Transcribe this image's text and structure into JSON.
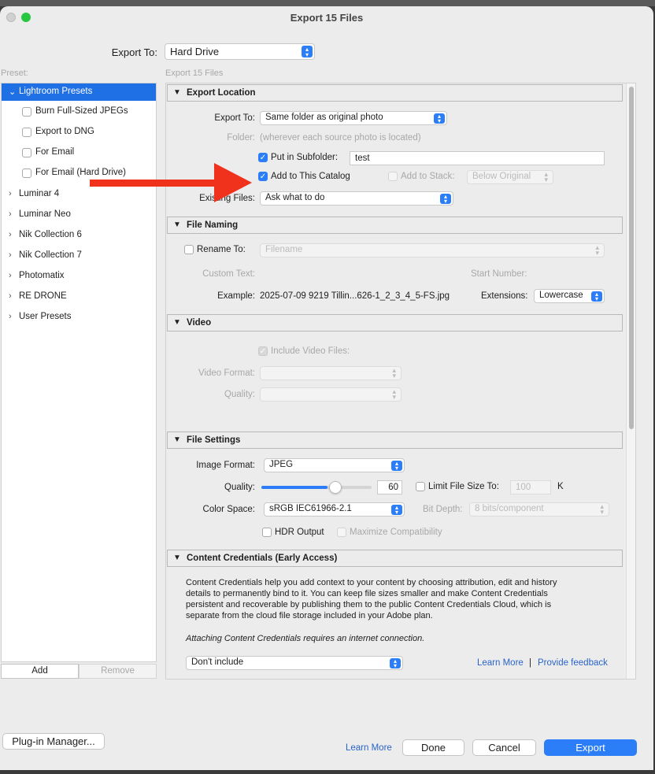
{
  "window": {
    "title": "Export 15 Files"
  },
  "header": {
    "export_to_label": "Export To:",
    "export_to_value": "Hard Drive",
    "subtitle": "Export 15 Files"
  },
  "sidebar": {
    "preset_label": "Preset:",
    "groups": [
      {
        "label": "Lightroom Presets",
        "expanded": true
      },
      {
        "label": "Luminar 4"
      },
      {
        "label": "Luminar Neo"
      },
      {
        "label": "Nik Collection 6"
      },
      {
        "label": "Nik Collection 7"
      },
      {
        "label": "Photomatix"
      },
      {
        "label": "RE DRONE"
      },
      {
        "label": "User Presets"
      }
    ],
    "presets": [
      "Burn Full-Sized JPEGs",
      "Export to DNG",
      "For Email",
      "For Email (Hard Drive)"
    ],
    "add_label": "Add",
    "remove_label": "Remove"
  },
  "export_location": {
    "header": "Export Location",
    "export_to_label": "Export To:",
    "export_to_value": "Same folder as original photo",
    "folder_label": "Folder:",
    "folder_value": "(wherever each source photo is located)",
    "subfolder_label": "Put in Subfolder:",
    "subfolder_value": "test",
    "add_catalog_label": "Add to This Catalog",
    "add_stack_label": "Add to Stack:",
    "stack_value": "Below Original",
    "existing_label": "Existing Files:",
    "existing_value": "Ask what to do"
  },
  "file_naming": {
    "header": "File Naming",
    "rename_label": "Rename To:",
    "rename_value": "Filename",
    "custom_text_label": "Custom Text:",
    "start_number_label": "Start Number:",
    "example_label": "Example:",
    "example_value": "2025-07-09 9219 Tillin...626-1_2_3_4_5-FS.jpg",
    "extensions_label": "Extensions:",
    "extensions_value": "Lowercase"
  },
  "video": {
    "header": "Video",
    "include_label": "Include Video Files:",
    "format_label": "Video Format:",
    "quality_label": "Quality:"
  },
  "file_settings": {
    "header": "File Settings",
    "format_label": "Image Format:",
    "format_value": "JPEG",
    "quality_label": "Quality:",
    "quality_value": "60",
    "quality_fraction": 0.6,
    "limit_label": "Limit File Size To:",
    "limit_value": "100",
    "limit_unit": "K",
    "colorspace_label": "Color Space:",
    "colorspace_value": "sRGB IEC61966-2.1",
    "bitdepth_label": "Bit Depth:",
    "bitdepth_value": "8 bits/component",
    "hdr_label": "HDR Output",
    "maximize_label": "Maximize Compatibility"
  },
  "content_credentials": {
    "header": "Content Credentials (Early Access)",
    "body_lines": [
      "Content Credentials help you add context to your content by choosing attribution, edit and history",
      "details to permanently bind to it. You can keep file sizes smaller and make Content Credentials",
      "persistent and recoverable by publishing them to the public Content Credentials Cloud, which is",
      "separate from the cloud file storage included in your Adobe plan."
    ],
    "note": "Attaching Content Credentials requires an internet connection.",
    "dropdown_value": "Don't include",
    "learn_more": "Learn More",
    "separator": "|",
    "feedback": "Provide feedback"
  },
  "footer": {
    "plugin_manager": "Plug-in Manager...",
    "learn_more": "Learn More",
    "done": "Done",
    "cancel": "Cancel",
    "export": "Export"
  },
  "colors": {
    "accent": "#2b7ef7",
    "arrow": "#f0321c",
    "selection": "#1f6fe5"
  }
}
